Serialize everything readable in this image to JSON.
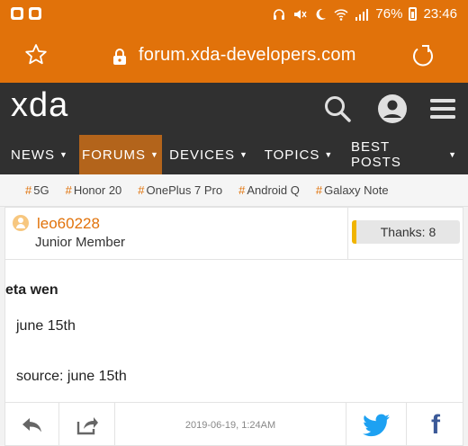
{
  "status_bar": {
    "battery_percent": "76%",
    "time": "23:46"
  },
  "url_bar": {
    "url": "forum.xda-developers.com"
  },
  "header": {
    "logo": "xda"
  },
  "nav": {
    "items": [
      {
        "label": "NEWS"
      },
      {
        "label": "FORUMS"
      },
      {
        "label": "DEVICES"
      },
      {
        "label": "TOPICS"
      },
      {
        "label": "BEST POSTS"
      }
    ],
    "active": "FORUMS"
  },
  "hashtags": [
    {
      "label": "5G"
    },
    {
      "label": "Honor 20"
    },
    {
      "label": "OnePlus 7 Pro"
    },
    {
      "label": "Android Q"
    },
    {
      "label": "Galaxy Note"
    }
  ],
  "post": {
    "username": "leo60228",
    "user_title": "Junior Member",
    "thanks": "Thanks: 8",
    "title": "eta wen",
    "line1": "june 15th",
    "line2": "source: june 15th",
    "date": "2019-06-19, 1:24AM"
  },
  "icons": {
    "status_left": [
      "notification-badge-icon",
      "notification-badge-icon"
    ],
    "status_right": [
      "headset-icon",
      "mute-icon",
      "moon-icon",
      "wifi-icon",
      "signal-icon",
      "battery-icon"
    ],
    "url_bar": [
      "star-icon",
      "lock-icon",
      "reload-icon"
    ],
    "header": [
      "search-icon",
      "account-icon",
      "menu-icon"
    ],
    "post_footer": [
      "reply-icon",
      "share-icon",
      "twitter-icon",
      "facebook-icon"
    ]
  },
  "colors": {
    "brand_orange": "#e1720a",
    "header_dark": "#303030",
    "active_nav": "#b3641b",
    "thanks_accent": "#f0b400",
    "twitter_blue": "#1da1f2",
    "facebook_blue": "#3b5998"
  }
}
